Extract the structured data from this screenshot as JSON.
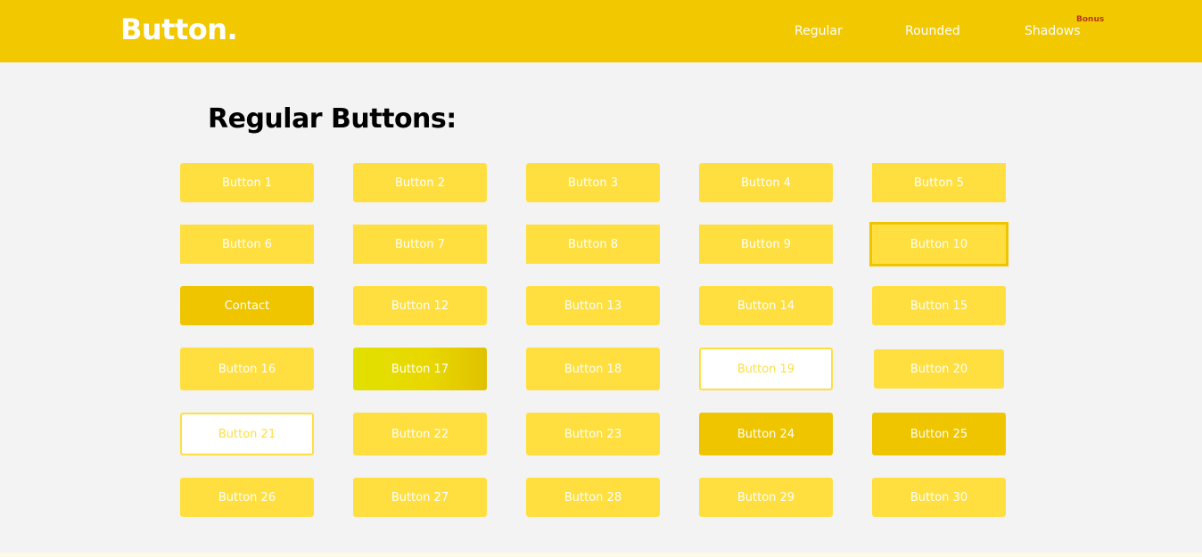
{
  "header": {
    "logo": "Button.",
    "nav": {
      "regular": "Regular",
      "rounded": "Rounded",
      "shadows": "Shadows",
      "bonus": "Bonus"
    }
  },
  "main": {
    "title": "Regular Buttons:",
    "buttons": {
      "b1": "Button 1",
      "b2": "Button 2",
      "b3": "Button 3",
      "b4": "Button 4",
      "b5": "Button 5",
      "b6": "Button 6",
      "b7": "Button 7",
      "b8": "Button 8",
      "b9": "Button 9",
      "b10": "Button 10",
      "b11": "Contact",
      "b12": "Button 12",
      "b13": "Button 13",
      "b14": "Button 14",
      "b15": "Button 15",
      "b16": "Button 16",
      "b17": "Button 17",
      "b18": "Button 18",
      "b19": "Button 19",
      "b20": "Button 20",
      "b21": "Button 21",
      "b22": "Button 22",
      "b23": "Button 23",
      "b24": "Button 24",
      "b25": "Button 25",
      "b26": "Button 26",
      "b27": "Button 27",
      "b28": "Button 28",
      "b29": "Button 29",
      "b30": "Button 30"
    }
  },
  "colors": {
    "header_bg": "#f2c800",
    "button_bg": "#ffdf40",
    "button_dark": "#efc500",
    "page_bg": "#f3f3f3",
    "bonus": "#b33a1a"
  }
}
